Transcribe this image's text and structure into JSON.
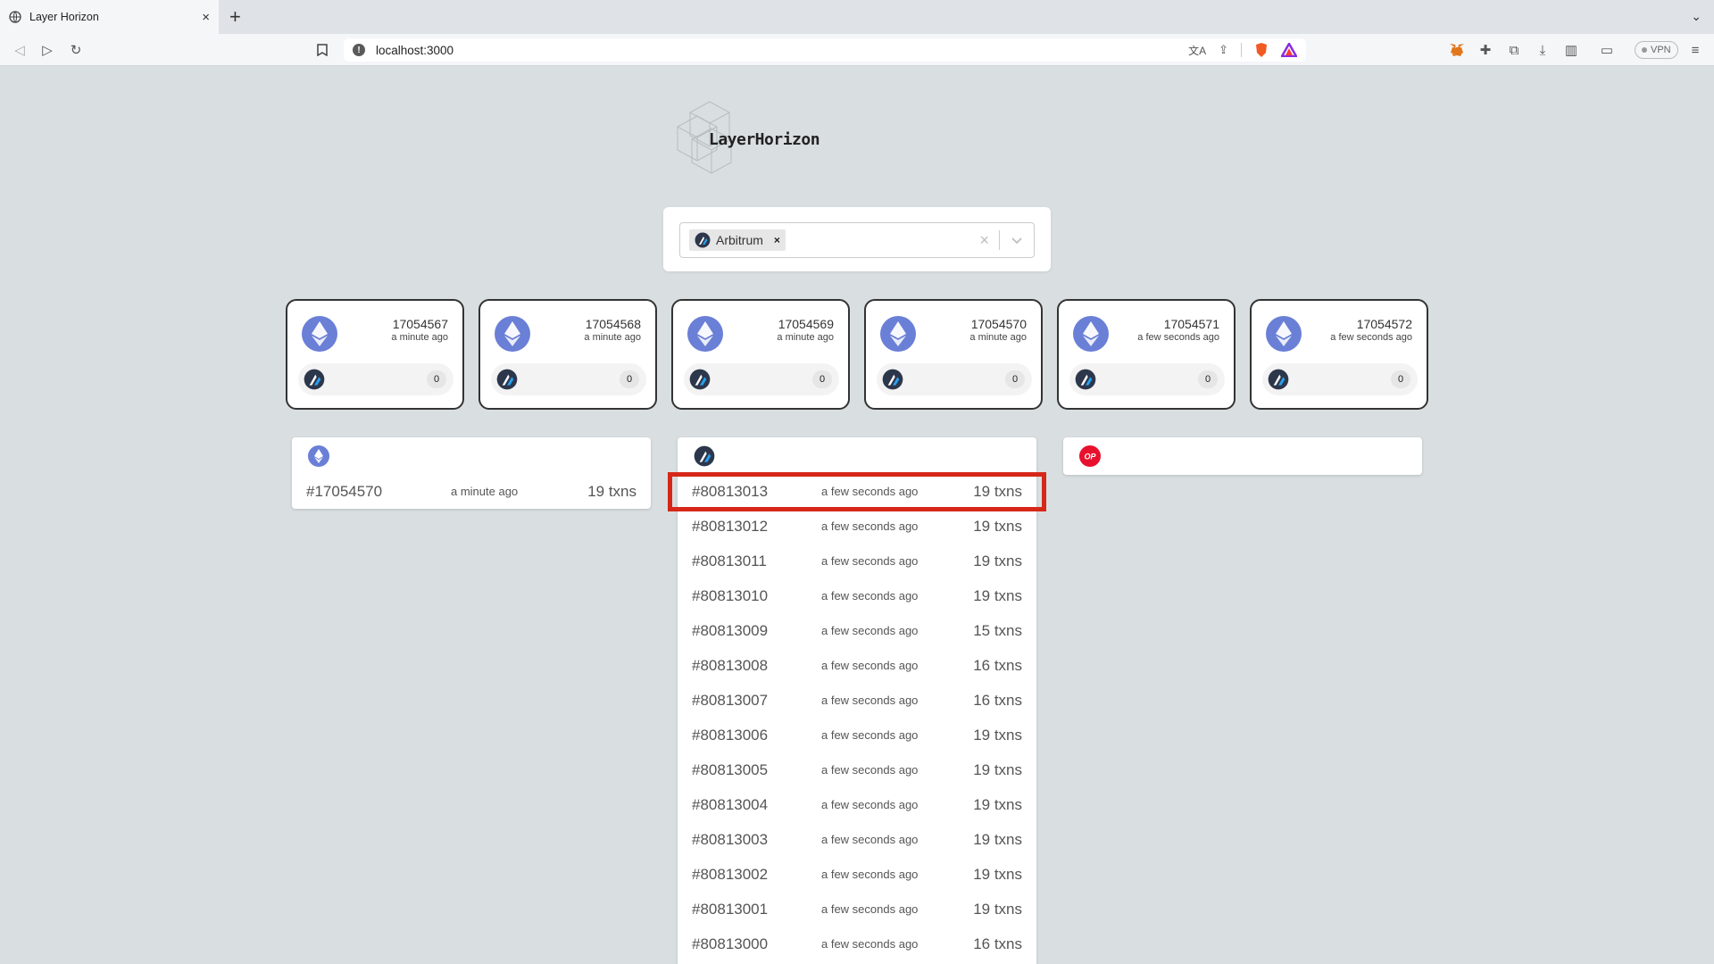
{
  "browser": {
    "tab_title": "Layer Horizon",
    "url": "localhost:3000",
    "vpn_label": "VPN"
  },
  "app": {
    "logo_text": "LayerHorizon"
  },
  "selector": {
    "selected_chip": "Arbitrum"
  },
  "l1_blocks": [
    {
      "number": "17054567",
      "ago": "a minute ago",
      "count": "0"
    },
    {
      "number": "17054568",
      "ago": "a minute ago",
      "count": "0"
    },
    {
      "number": "17054569",
      "ago": "a minute ago",
      "count": "0"
    },
    {
      "number": "17054570",
      "ago": "a minute ago",
      "count": "0"
    },
    {
      "number": "17054571",
      "ago": "a few seconds ago",
      "count": "0"
    },
    {
      "number": "17054572",
      "ago": "a few seconds ago",
      "count": "0"
    }
  ],
  "eth_panel": {
    "rows": [
      {
        "block": "#17054570",
        "ago": "a minute ago",
        "txns": "19 txns"
      }
    ]
  },
  "arb_panel": {
    "rows": [
      {
        "block": "#80813013",
        "ago": "a few seconds ago",
        "txns": "19 txns"
      },
      {
        "block": "#80813012",
        "ago": "a few seconds ago",
        "txns": "19 txns"
      },
      {
        "block": "#80813011",
        "ago": "a few seconds ago",
        "txns": "19 txns"
      },
      {
        "block": "#80813010",
        "ago": "a few seconds ago",
        "txns": "19 txns"
      },
      {
        "block": "#80813009",
        "ago": "a few seconds ago",
        "txns": "15 txns"
      },
      {
        "block": "#80813008",
        "ago": "a few seconds ago",
        "txns": "16 txns"
      },
      {
        "block": "#80813007",
        "ago": "a few seconds ago",
        "txns": "16 txns"
      },
      {
        "block": "#80813006",
        "ago": "a few seconds ago",
        "txns": "19 txns"
      },
      {
        "block": "#80813005",
        "ago": "a few seconds ago",
        "txns": "19 txns"
      },
      {
        "block": "#80813004",
        "ago": "a few seconds ago",
        "txns": "19 txns"
      },
      {
        "block": "#80813003",
        "ago": "a few seconds ago",
        "txns": "19 txns"
      },
      {
        "block": "#80813002",
        "ago": "a few seconds ago",
        "txns": "19 txns"
      },
      {
        "block": "#80813001",
        "ago": "a few seconds ago",
        "txns": "19 txns"
      },
      {
        "block": "#80813000",
        "ago": "a few seconds ago",
        "txns": "16 txns"
      }
    ]
  },
  "op_panel": {
    "badge": "OP"
  },
  "colors": {
    "eth": "#6a7fd6",
    "op": "#e8112d",
    "highlight": "#d62718"
  }
}
